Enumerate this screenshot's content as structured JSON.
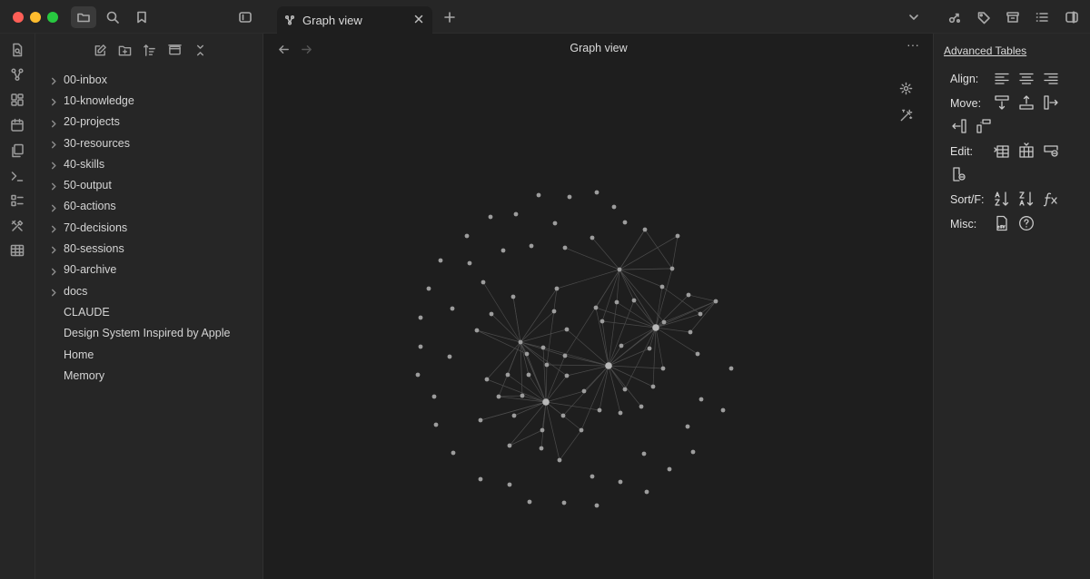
{
  "window": {
    "tab_title": "Graph view",
    "view_title": "Graph view"
  },
  "titlebar_icons": [
    "files-icon",
    "search-icon",
    "bookmark-icon",
    "sidebar-toggle-icon",
    "chevron-down-icon",
    "share-icon",
    "tag-icon",
    "archive-icon",
    "outline-icon",
    "right-sidebar-icon"
  ],
  "ribbon_icons": [
    "quick-switcher-icon",
    "graph-icon",
    "canvas-icon",
    "calendar-icon",
    "templates-icon",
    "terminal-icon",
    "command-palette-icon",
    "tools-icon",
    "table-icon"
  ],
  "sidebar": {
    "items": [
      {
        "label": "00-inbox",
        "folder": true
      },
      {
        "label": "10-knowledge",
        "folder": true
      },
      {
        "label": "20-projects",
        "folder": true
      },
      {
        "label": "30-resources",
        "folder": true
      },
      {
        "label": "40-skills",
        "folder": true
      },
      {
        "label": "50-output",
        "folder": true
      },
      {
        "label": "60-actions",
        "folder": true
      },
      {
        "label": "70-decisions",
        "folder": true
      },
      {
        "label": "80-sessions",
        "folder": true
      },
      {
        "label": "90-archive",
        "folder": true
      },
      {
        "label": "docs",
        "folder": true
      },
      {
        "label": "CLAUDE",
        "folder": false
      },
      {
        "label": "Design System Inspired by Apple",
        "folder": false
      },
      {
        "label": "Home",
        "folder": false
      },
      {
        "label": "Memory",
        "folder": false
      }
    ]
  },
  "right_panel": {
    "title": "Advanced Tables",
    "align_label": "Align:",
    "move_label": "Move:",
    "edit_label": "Edit:",
    "sort_label": "Sort/F:",
    "misc_label": "Misc:"
  }
}
